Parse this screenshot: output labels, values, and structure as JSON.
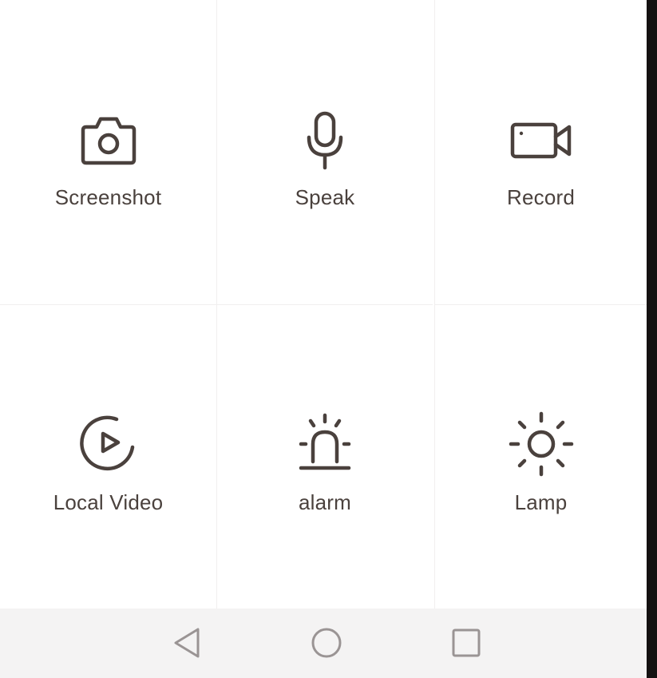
{
  "controls": [
    {
      "label": "Screenshot",
      "icon": "camera-icon"
    },
    {
      "label": "Speak",
      "icon": "microphone-icon"
    },
    {
      "label": "Record",
      "icon": "video-camera-icon"
    },
    {
      "label": "Local Video",
      "icon": "play-circle-icon"
    },
    {
      "label": "alarm",
      "icon": "siren-icon"
    },
    {
      "label": "Lamp",
      "icon": "sun-icon"
    }
  ],
  "navbar": {
    "back_icon": "back-triangle-icon",
    "home_icon": "home-circle-icon",
    "recent_icon": "recent-apps-square-icon"
  },
  "colors": {
    "icon": "#4a413d",
    "background": "#ffffff",
    "navbar": "#f4f3f3",
    "nav_icon": "#9a9494"
  }
}
